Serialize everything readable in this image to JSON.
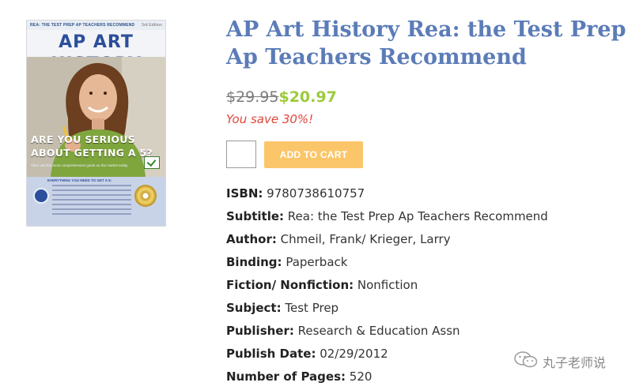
{
  "book": {
    "cover": {
      "strip_text": "REA: THE TEST PREP AP TEACHERS RECOMMEND",
      "edition": "3rd Edition",
      "title": "AP ART HISTORY",
      "headline": "ARE YOU SERIOUS ABOUT GETTING A 5?",
      "tagline": "Then use the most comprehensive guide on the market today",
      "lower_heading": "EVERYTHING YOU NEED TO GET A 5:"
    },
    "title": "AP Art History Rea: the Test Prep Ap Teachers Recommend",
    "price_original": "$29.95",
    "price_sale": "$20.97",
    "savings": "You save 30%!",
    "quantity": "",
    "add_to_cart_label": "ADD TO CART",
    "details": [
      {
        "label": "ISBN:",
        "value": "9780738610757"
      },
      {
        "label": "Subtitle:",
        "value": "Rea: the Test Prep Ap Teachers Recommend"
      },
      {
        "label": "Author:",
        "value": "Chmeil, Frank/ Krieger, Larry"
      },
      {
        "label": "Binding:",
        "value": "Paperback"
      },
      {
        "label": "Fiction/ Nonfiction:",
        "value": "Nonfiction"
      },
      {
        "label": "Subject:",
        "value": "Test Prep"
      },
      {
        "label": "Publisher:",
        "value": "Research & Education Assn"
      },
      {
        "label": "Publish Date:",
        "value": "02/29/2012"
      },
      {
        "label": "Number of Pages:",
        "value": "520"
      }
    ]
  },
  "watermark": {
    "icon": "wechat-icon",
    "text": "丸子老师说"
  },
  "colors": {
    "title": "#5b7cb8",
    "sale_price": "#9ccb3c",
    "savings": "#e0463a",
    "add_to_cart": "#fbc66a"
  }
}
